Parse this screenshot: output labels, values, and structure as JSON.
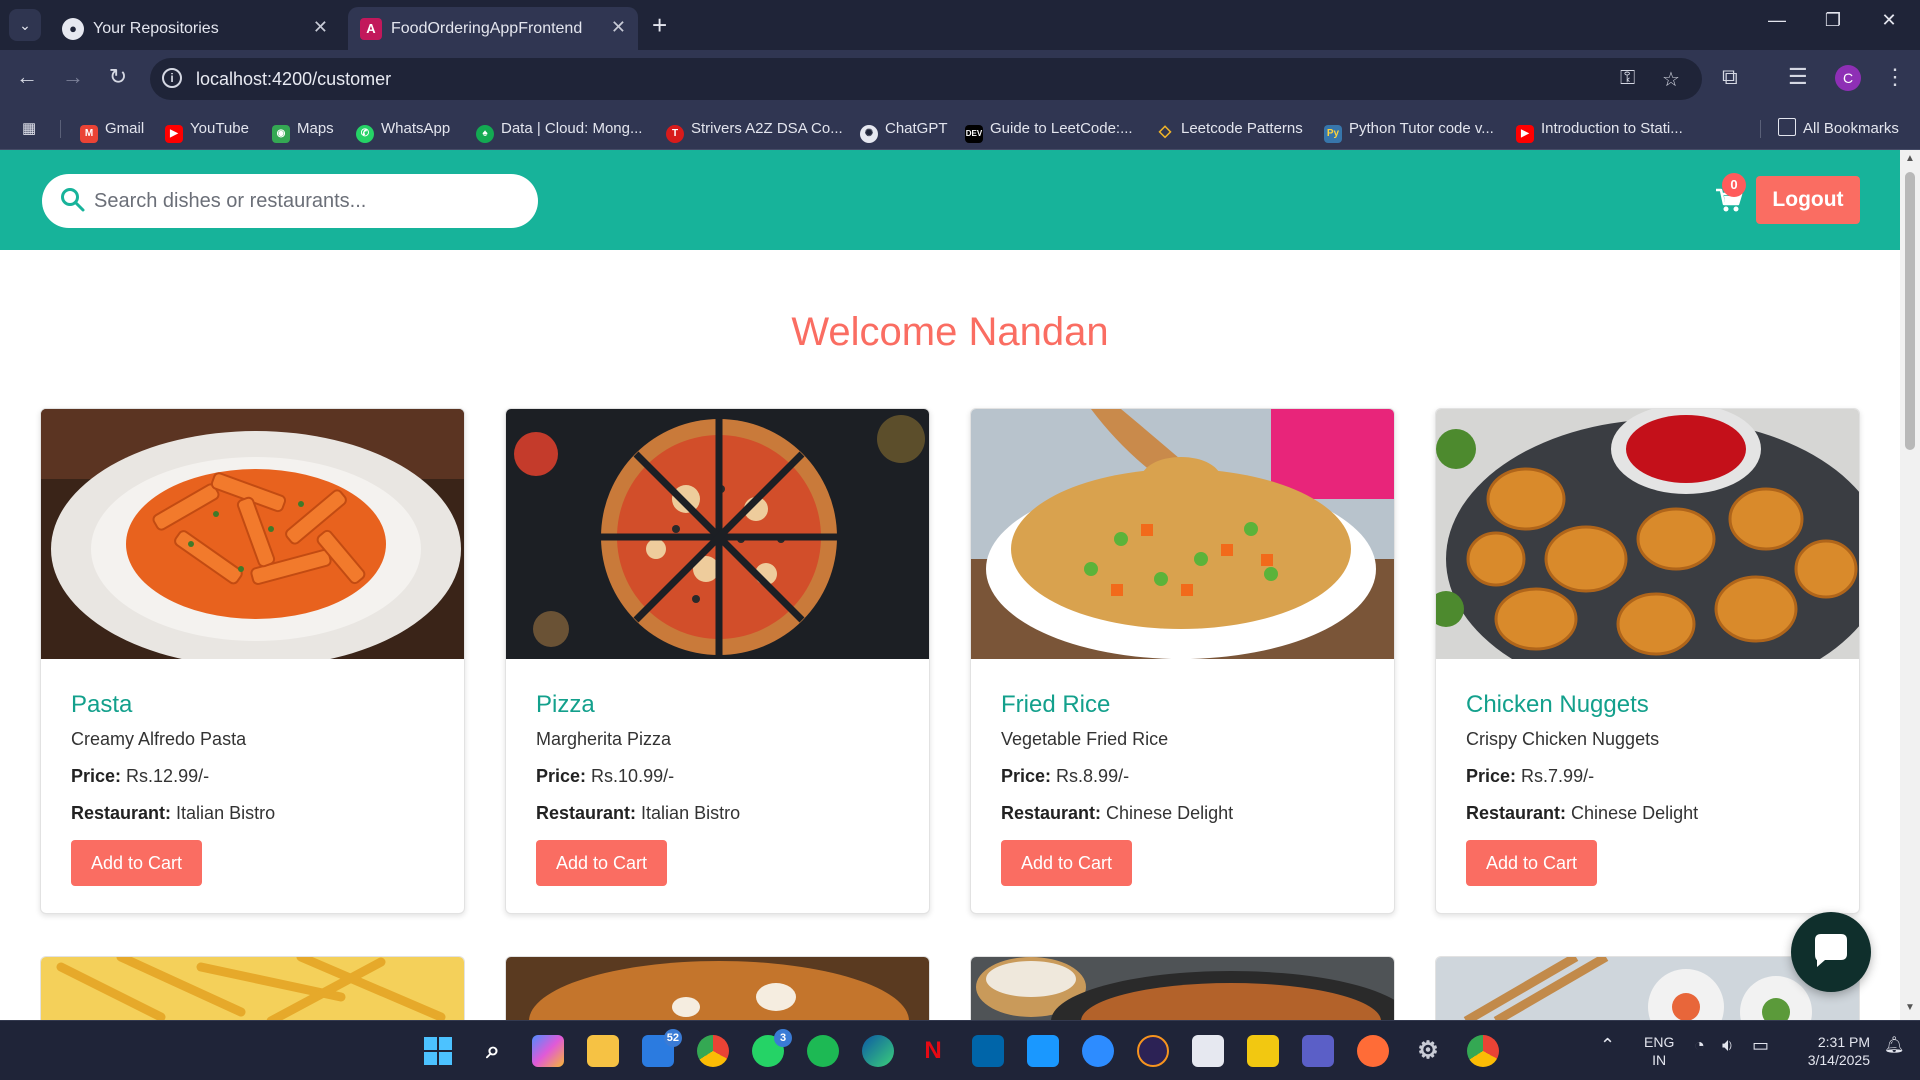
{
  "browser": {
    "tabs": [
      {
        "title": "Your Repositories",
        "icon": "github-icon"
      },
      {
        "title": "FoodOrderingAppFrontend",
        "icon": "angular-icon"
      }
    ],
    "url": "localhost:4200/customer",
    "profile_initial": "C",
    "bookmarks": [
      {
        "label": "Gmail"
      },
      {
        "label": "YouTube"
      },
      {
        "label": "Maps"
      },
      {
        "label": "WhatsApp"
      },
      {
        "label": "Data | Cloud: Mong..."
      },
      {
        "label": "Strivers A2Z DSA Co..."
      },
      {
        "label": "ChatGPT"
      },
      {
        "label": "Guide to LeetCode:..."
      },
      {
        "label": "Leetcode Patterns"
      },
      {
        "label": "Python Tutor code v..."
      },
      {
        "label": "Introduction to Stati..."
      }
    ],
    "all_bookmarks": "All Bookmarks"
  },
  "app": {
    "search_placeholder": "Search dishes or restaurants...",
    "cart_count": "0",
    "logout_label": "Logout",
    "welcome": "Welcome Nandan",
    "price_label": "Price:",
    "restaurant_label": "Restaurant:",
    "add_label": "Add to Cart",
    "dishes": [
      {
        "name": "Pasta",
        "description": "Creamy Alfredo Pasta",
        "price": "Rs.12.99/-",
        "restaurant": "Italian Bistro"
      },
      {
        "name": "Pizza",
        "description": "Margherita Pizza",
        "price": "Rs.10.99/-",
        "restaurant": "Italian Bistro"
      },
      {
        "name": "Fried Rice",
        "description": "Vegetable Fried Rice",
        "price": "Rs.8.99/-",
        "restaurant": "Chinese Delight"
      },
      {
        "name": "Chicken Nuggets",
        "description": "Crispy Chicken Nuggets",
        "price": "Rs.7.99/-",
        "restaurant": "Chinese Delight"
      }
    ]
  },
  "taskbar": {
    "badge_mail": "52",
    "badge_whatsapp": "3",
    "lang": "ENG",
    "region": "IN",
    "time": "2:31 PM",
    "date": "3/14/2025"
  },
  "colors": {
    "header": "#17b39a",
    "accent": "#fa6d62",
    "dish_title": "#13a08c"
  }
}
